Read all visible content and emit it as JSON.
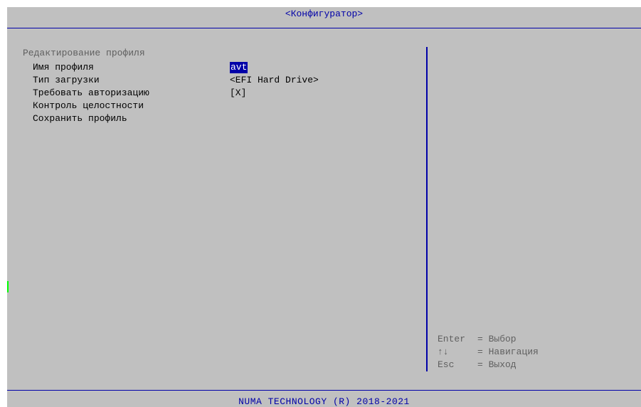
{
  "header": {
    "title": "<Конфигуратор>"
  },
  "section": {
    "title": "Редактирование профиля"
  },
  "menu": {
    "items": [
      {
        "label": "Имя профиля",
        "value": "avt"
      },
      {
        "label": "Тип загрузки",
        "value": "<EFI Hard Drive>"
      },
      {
        "label": "Требовать авторизацию",
        "value": "[X]"
      },
      {
        "label": "Контроль целостности",
        "value": ""
      },
      {
        "label": "Сохранить профиль",
        "value": ""
      }
    ]
  },
  "help": {
    "items": [
      {
        "key": "Enter",
        "desc": "= Выбор"
      },
      {
        "key": "↑↓",
        "desc": "= Навигация"
      },
      {
        "key": "Esc",
        "desc": "= Выход"
      }
    ]
  },
  "footer": {
    "text": "NUMA TECHNOLOGY (R) 2018-2021"
  },
  "colors": {
    "background": "#c0c0c0",
    "accent": "#0000a8",
    "selection_bg": "#0000a8",
    "selection_fg": "#ffffff",
    "cursor": "#00ff00"
  }
}
